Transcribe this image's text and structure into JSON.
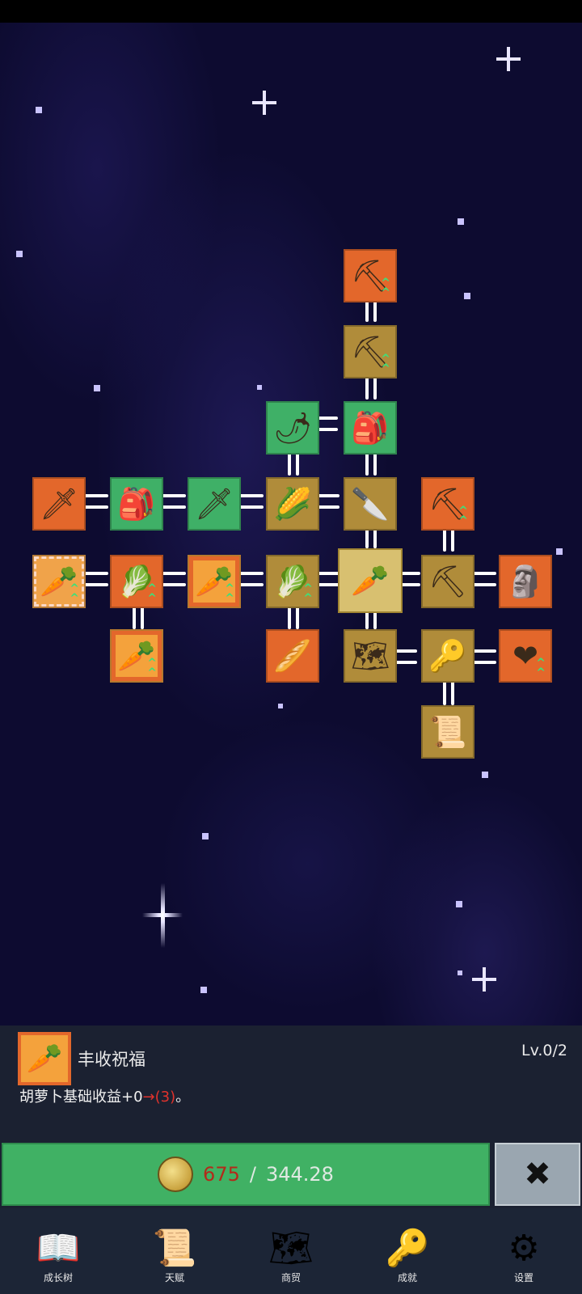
{
  "tree": {
    "nodes": [
      {
        "id": "n1",
        "icon": "shovel-icon",
        "glyph": "⛏",
        "color": "orange",
        "upgrade": true
      },
      {
        "id": "n2",
        "icon": "shovel-icon",
        "glyph": "⛏",
        "color": "gold",
        "upgrade": true
      },
      {
        "id": "n3",
        "icon": "chili-pepper-icon",
        "glyph": "🌶",
        "color": "green",
        "upgrade": false
      },
      {
        "id": "n4",
        "icon": "backpack-icon",
        "glyph": "🎒",
        "color": "green",
        "upgrade": false
      },
      {
        "id": "n5",
        "icon": "sword-icon",
        "glyph": "🗡",
        "color": "orange",
        "upgrade": false
      },
      {
        "id": "n6",
        "icon": "backpack-icon",
        "glyph": "🎒",
        "color": "green",
        "upgrade": false
      },
      {
        "id": "n7",
        "icon": "sword-icon",
        "glyph": "🗡",
        "color": "green",
        "upgrade": false
      },
      {
        "id": "n8",
        "icon": "corn-icon",
        "glyph": "🌽",
        "color": "gold",
        "upgrade": false
      },
      {
        "id": "n9",
        "icon": "knife-icon",
        "glyph": "🔪",
        "color": "gold",
        "upgrade": false
      },
      {
        "id": "n10",
        "icon": "pickaxe-icon",
        "glyph": "⛏",
        "color": "orange",
        "upgrade": true
      },
      {
        "id": "n11",
        "icon": "carrot-icon",
        "glyph": "🥕",
        "color": "dashed",
        "upgrade": true
      },
      {
        "id": "n12",
        "icon": "cabbage-icon",
        "glyph": "🥬",
        "color": "orange",
        "upgrade": true
      },
      {
        "id": "n13",
        "icon": "carrot-icon",
        "glyph": "🥕",
        "color": "carrot",
        "upgrade": true
      },
      {
        "id": "n14",
        "icon": "cabbage-icon",
        "glyph": "🥬",
        "color": "gold",
        "upgrade": true
      },
      {
        "id": "n15",
        "icon": "carrot-icon",
        "glyph": "🥕",
        "color": "sel",
        "upgrade": false
      },
      {
        "id": "n16",
        "icon": "pickaxe-icon",
        "glyph": "⛏",
        "color": "gold",
        "upgrade": false
      },
      {
        "id": "n17",
        "icon": "statue-icon",
        "glyph": "🗿",
        "color": "orange",
        "upgrade": false
      },
      {
        "id": "n18",
        "icon": "carrot-icon",
        "glyph": "🥕",
        "color": "carrot",
        "upgrade": true
      },
      {
        "id": "n19",
        "icon": "parsnip-icon",
        "glyph": "🥖",
        "color": "orange",
        "upgrade": false
      },
      {
        "id": "n20",
        "icon": "map-icon",
        "glyph": "🗺",
        "color": "gold",
        "upgrade": false
      },
      {
        "id": "n21",
        "icon": "key-icon",
        "glyph": "🔑",
        "color": "gold",
        "upgrade": false
      },
      {
        "id": "n22",
        "icon": "heart-icon",
        "glyph": "❤",
        "color": "orange",
        "upgrade": true
      },
      {
        "id": "n23",
        "icon": "scroll-icon",
        "glyph": "📜",
        "color": "gold",
        "upgrade": false
      }
    ]
  },
  "detail": {
    "icon": "carrot-icon",
    "glyph": "🥕",
    "name": "丰收祝福",
    "level": "Lv.0/2",
    "desc_prefix": "胡萝卜基础收益+0",
    "desc_arrow": "→",
    "desc_new": "(3)",
    "desc_suffix": "。"
  },
  "upgrade": {
    "cost": "675",
    "separator": "/",
    "owned": "344.28",
    "close_glyph": "✖"
  },
  "nav": [
    {
      "label": "成长树",
      "icon": "book-icon",
      "glyph": "📖"
    },
    {
      "label": "天赋",
      "icon": "scroll-icon",
      "glyph": "📜"
    },
    {
      "label": "商贸",
      "icon": "map-icon",
      "glyph": "🗺"
    },
    {
      "label": "成就",
      "icon": "key-icon",
      "glyph": "🔑"
    },
    {
      "label": "设置",
      "icon": "gear-icon",
      "glyph": "⚙"
    }
  ]
}
